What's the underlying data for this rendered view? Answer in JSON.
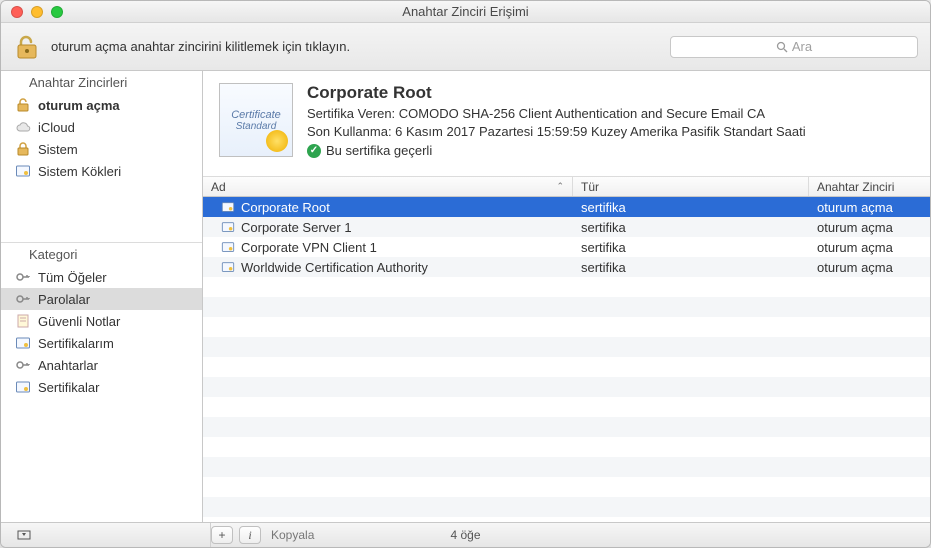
{
  "window": {
    "title": "Anahtar Zinciri Erişimi"
  },
  "toolbar": {
    "lock_hint": "oturum açma anahtar zincirini kilitlemek için tıklayın.",
    "search_placeholder": "Ara"
  },
  "sidebar": {
    "keychains_header": "Anahtar Zincirleri",
    "keychains": [
      {
        "label": "oturum açma",
        "icon": "lock-open",
        "bold": true
      },
      {
        "label": "iCloud",
        "icon": "cloud"
      },
      {
        "label": "Sistem",
        "icon": "lock-closed"
      },
      {
        "label": "Sistem Kökleri",
        "icon": "cert"
      }
    ],
    "category_header": "Kategori",
    "categories": [
      {
        "label": "Tüm Öğeler",
        "icon": "key"
      },
      {
        "label": "Parolalar",
        "icon": "key",
        "selected": true
      },
      {
        "label": "Güvenli Notlar",
        "icon": "note"
      },
      {
        "label": "Sertifikalarım",
        "icon": "cert"
      },
      {
        "label": "Anahtarlar",
        "icon": "key"
      },
      {
        "label": "Sertifikalar",
        "icon": "cert"
      }
    ]
  },
  "detail": {
    "title": "Corporate Root",
    "issuer_label": "Sertifika Veren: COMODO SHA-256 Client Authentication and Secure Email CA",
    "expires_label": "Son Kullanma: 6 Kasım 2017 Pazartesi 15:59:59 Kuzey Amerika Pasifik Standart Saati",
    "valid_text": "Bu sertifika geçerli",
    "badge_line1": "Certificate",
    "badge_line2": "Standard"
  },
  "table": {
    "columns": {
      "name": "Ad",
      "type": "Tür",
      "keychain": "Anahtar Zinciri"
    },
    "rows": [
      {
        "name": "Corporate Root",
        "type": "sertifika",
        "keychain": "oturum açma",
        "selected": true
      },
      {
        "name": "Corporate Server 1",
        "type": "sertifika",
        "keychain": "oturum açma"
      },
      {
        "name": "Corporate VPN Client 1",
        "type": "sertifika",
        "keychain": "oturum açma"
      },
      {
        "name": "Worldwide Certification Authority",
        "type": "sertifika",
        "keychain": "oturum açma"
      }
    ]
  },
  "statusbar": {
    "copy_label": "Kopyala",
    "item_count": "4 öğe"
  }
}
